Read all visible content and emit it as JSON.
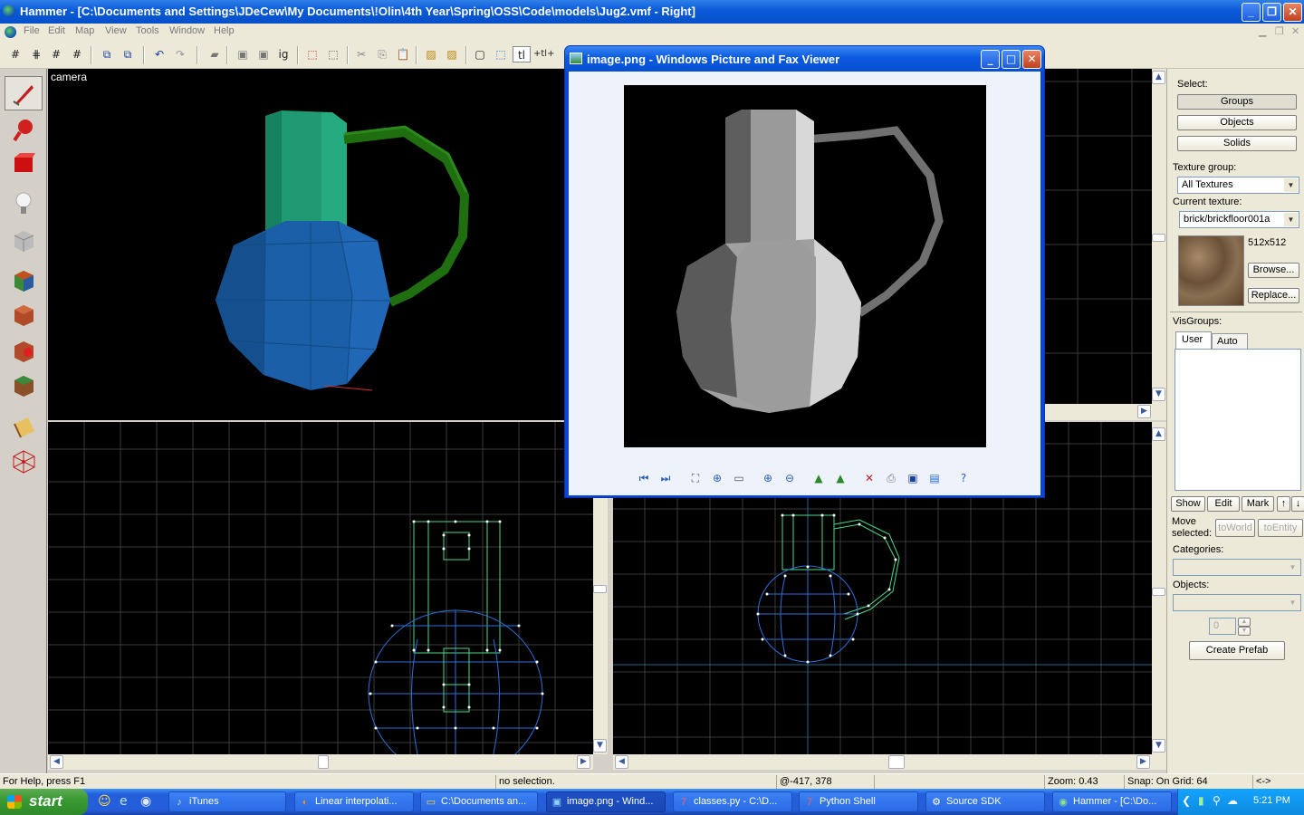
{
  "app": {
    "title": "Hammer - [C:\\Documents and Settings\\JDeCew\\My Documents\\!Olin\\4th Year\\Spring\\OSS\\Code\\models\\Jug2.vmf - Right]",
    "menus": [
      "File",
      "Edit",
      "Map",
      "View",
      "Tools",
      "Window",
      "Help"
    ]
  },
  "toolbar": {
    "text_buttons": [
      "tl",
      "+tl+",
      "ig"
    ]
  },
  "viewports": {
    "camera_label": "camera"
  },
  "right_panel": {
    "select_label": "Select:",
    "groups": "Groups",
    "objects": "Objects",
    "solids": "Solids",
    "texture_group_label": "Texture group:",
    "texture_group_value": "All Textures",
    "current_texture_label": "Current texture:",
    "current_texture_value": "brick/brickfloor001a",
    "texture_size": "512x512",
    "browse": "Browse...",
    "replace": "Replace...",
    "visgroups_label": "VisGroups:",
    "tab_user": "User",
    "tab_auto": "Auto",
    "show": "Show",
    "edit": "Edit",
    "mark": "Mark",
    "move_selected_1": "Move",
    "move_selected_2": "selected:",
    "to_world": "toWorld",
    "to_entity": "toEntity",
    "categories_label": "Categories:",
    "objects_label": "Objects:",
    "count_value": "0",
    "create_prefab": "Create Prefab"
  },
  "viewer": {
    "title": "image.png - Windows Picture and Fax Viewer"
  },
  "status": {
    "help": "For Help, press F1",
    "selection": "no selection.",
    "coords": "@-417, 378",
    "zoom": "Zoom: 0.43",
    "snap": "Snap: On Grid: 64",
    "extra": "<->"
  },
  "taskbar": {
    "start": "start",
    "tasks": [
      "iTunes",
      "Linear interpolati...",
      "C:\\Documents an...",
      "image.png - Wind...",
      "classes.py - C:\\D...",
      "Python Shell",
      "Source SDK",
      "Hammer - [C:\\Do..."
    ],
    "clock": "5:21 PM"
  },
  "colors": {
    "jug_body": "#1a5fa8",
    "jug_neck": "#1f9a72",
    "jug_handle": "#1f6f10",
    "wire_blue": "#2f6fd8",
    "wire_green": "#4ad88a",
    "grid": "#3a3a3a",
    "xp_blue": "#0a5ad8"
  }
}
